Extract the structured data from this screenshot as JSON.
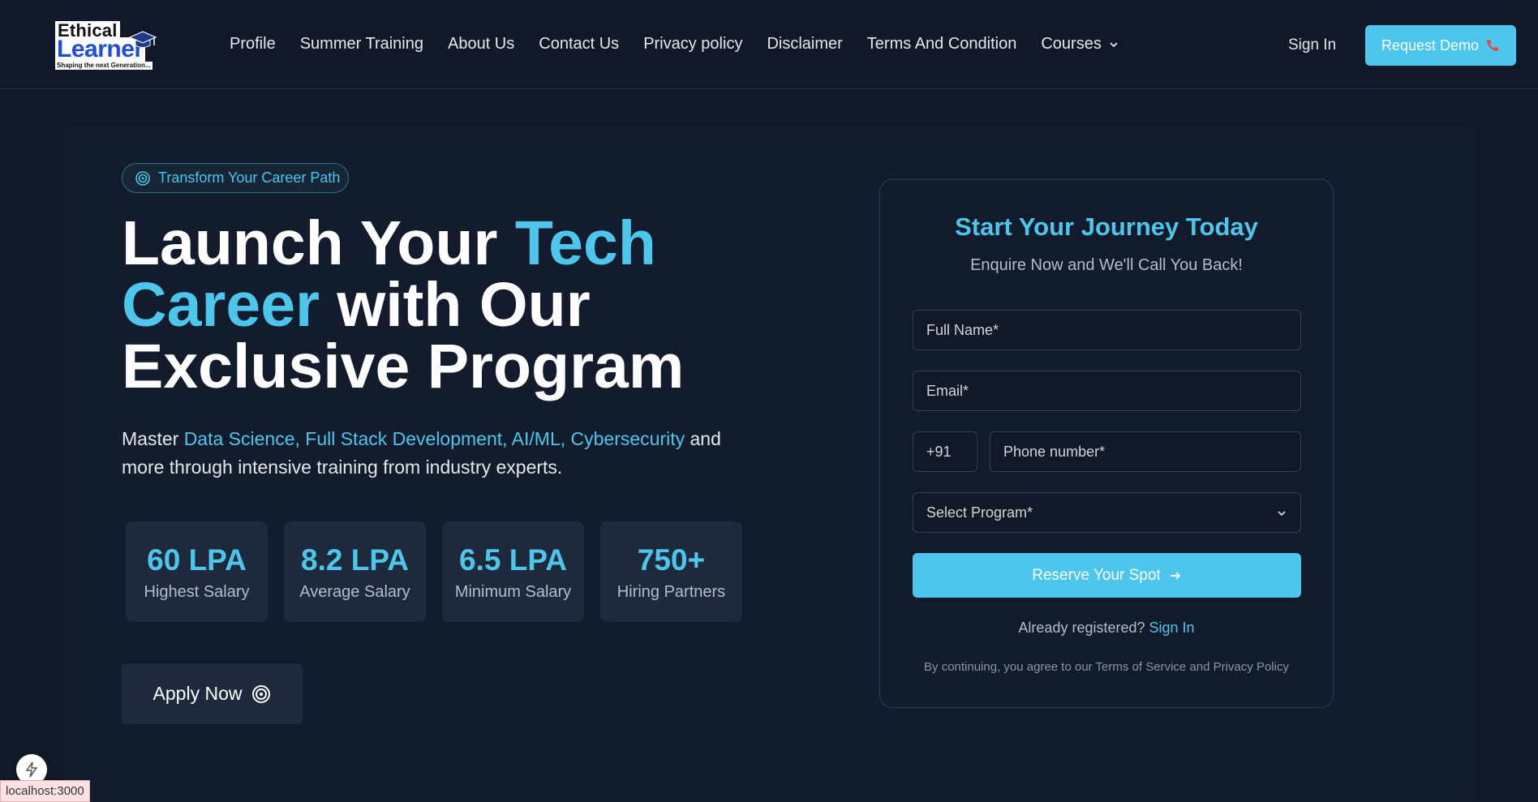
{
  "header": {
    "logo": {
      "top": "Ethical",
      "main": "Learner",
      "tagline": "Shaping the next Generation..."
    },
    "nav": [
      {
        "label": "Profile"
      },
      {
        "label": "Summer Training"
      },
      {
        "label": "About Us"
      },
      {
        "label": "Contact Us"
      },
      {
        "label": "Privacy policy"
      },
      {
        "label": "Disclaimer"
      },
      {
        "label": "Terms And Condition"
      },
      {
        "label": "Courses",
        "has_dropdown": true
      }
    ],
    "sign_in": "Sign In",
    "request_demo": "Request Demo",
    "request_demo_icon": "phone-icon"
  },
  "hero": {
    "badge": "Transform Your Career Path",
    "headline": {
      "part1": "Launch Your ",
      "accent1": "Tech Career",
      "part2": " with Our Exclusive Program"
    },
    "lead": {
      "prefix": "Master ",
      "accent": "Data Science, Full Stack Development, AI/ML, Cybersecurity",
      "suffix": " and more through intensive training from industry experts."
    },
    "stats": [
      {
        "value": "60 LPA",
        "label": "Highest Salary"
      },
      {
        "value": "8.2 LPA",
        "label": "Average Salary"
      },
      {
        "value": "6.5 LPA",
        "label": "Minimum Salary"
      },
      {
        "value": "750+",
        "label": "Hiring Partners"
      }
    ],
    "apply_button": "Apply Now"
  },
  "form": {
    "title": "Start Your Journey Today",
    "subtitle": "Enquire Now and We'll Call You Back!",
    "full_name_placeholder": "Full Name*",
    "email_placeholder": "Email*",
    "country_code": "+91",
    "phone_placeholder": "Phone number*",
    "program_placeholder": "Select Program*",
    "submit": "Reserve Your Spot",
    "already_text": "Already registered? ",
    "sign_in_link": "Sign In",
    "terms": "By continuing, you agree to our Terms of Service and Privacy Policy"
  },
  "status_bar": {
    "url": "localhost:3000"
  },
  "colors": {
    "accent": "#4cc6ec",
    "background": "#111827",
    "card": "#1e293b"
  }
}
